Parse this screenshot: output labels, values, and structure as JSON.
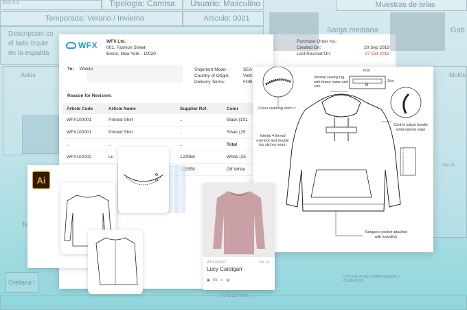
{
  "background": {
    "cells": {
      "tipologia": "Tipologia: Camisa",
      "usuario": "Usuario: Masculino",
      "muestras": "Muestras de telas",
      "temporada": "Temporada: Verano / Invierno",
      "articulo": "Articulo: 0001",
      "eko": "EKO S.A",
      "descripcion_1": "Descripcion co",
      "descripcion_2": "el lado izquie",
      "descripcion_3": "en la espalda",
      "sarga": "Sarga mediana",
      "gab": "Gab",
      "avios": "Avios",
      "molde": "Molde",
      "talle": "TALLE",
      "ta": "TA",
      "orellana": "Orellana I",
      "tapicostura": "TAPICOSTURA",
      "etiqueta": "ETIQUETA DE COMPOSICION Y CUIDADOS"
    }
  },
  "po": {
    "logo": "WFX",
    "company_name": "WFX Ltd.",
    "company_addr1": "001, Fashion Street",
    "company_addr2": "Bronx, New York - 10020",
    "po_label": "Purchase Order No.:",
    "created_label": "Created On:",
    "created_value": "20 Sep 2019",
    "revised_label": "Last Revised On:",
    "revised_value": "07 Oct 2019",
    "to_label": "To:",
    "to_value": "Welcio",
    "shipment_label": "Shipment Mode:",
    "shipment_value": "SEA",
    "origin_label": "Country of Origin:",
    "origin_value": "Vietr",
    "delivery_label": "Delivery Terms:",
    "delivery_value": "FOB",
    "reason_label": "Reason for Revision:",
    "columns": [
      "Article Code",
      "Article Name",
      "Supplier Ref.",
      "Color"
    ],
    "rows": [
      {
        "code": "WFX100001",
        "name": "Printed Shirt",
        "ref": "..",
        "color": "Black (101"
      },
      {
        "code": "WFX100001",
        "name": "Printed Shirt",
        "ref": "..",
        "color": "Silver (25"
      },
      {
        "code": "..",
        "name": "..",
        "ref": "..",
        "color": "Total"
      },
      {
        "code": "WFX100002",
        "name": "Lu",
        "ref": "122958",
        "color": "White (25"
      },
      {
        "code": "",
        "name": "",
        "ref": "122958",
        "color": "Off White"
      }
    ]
  },
  "spec": {
    "measure_w": "6cm",
    "measure_h": "3cm",
    "tag_letter": "M",
    "label_tag": "Internal sewing tag with brand name and size",
    "label_cover": "Cover seaming stitch",
    "label_cord": "Cord to adjust hoodie embroidered edge",
    "label_overlock": "Intertal 4 thread overlock and double top stiches seam",
    "label_kangaroo": "Kangaroo pocket attached with lockstitch"
  },
  "product": {
    "code": "WFX100002",
    "version": "Ver. #1",
    "name": "Lucy Cardigan",
    "meta_count": "5/1"
  },
  "illustrator": {
    "logo": "Ai"
  },
  "colors": {
    "brand": "#1aa0d8",
    "date_red": "#e53935",
    "ai_orange": "#ff9a00"
  }
}
